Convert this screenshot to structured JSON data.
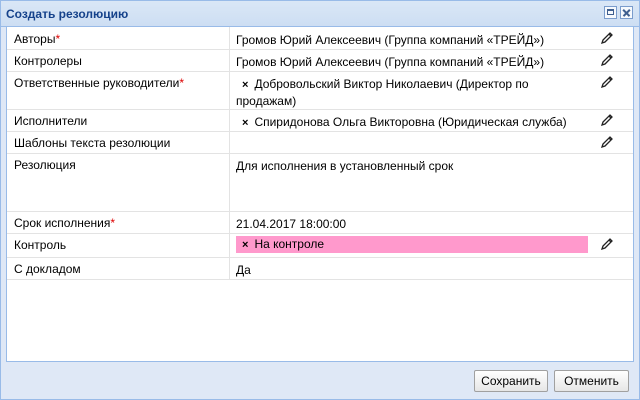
{
  "window": {
    "title": "Создать резолюцию"
  },
  "fields": {
    "authors": {
      "label": "Авторы",
      "required_mark": "*",
      "value": "Громов Юрий Алексеевич (Группа компаний «ТРЕЙД»)"
    },
    "controllers": {
      "label": "Контролеры",
      "value": "Громов Юрий Алексеевич (Группа компаний «ТРЕЙД»)"
    },
    "responsible": {
      "label": "Ответственные руководители",
      "required_mark": "*",
      "remove_glyph": "×",
      "value_line1": "Добровольский Виктор Николаевич (Директор по",
      "value_line2": "продажам)"
    },
    "executors": {
      "label": "Исполнители",
      "remove_glyph": "×",
      "value": "Спиридонова Ольга Викторовна (Юридическая служба)"
    },
    "templates": {
      "label": "Шаблоны текста резолюции",
      "value": ""
    },
    "resolution": {
      "label": "Резолюция",
      "value": "Для исполнения в установленный срок"
    },
    "deadline": {
      "label": "Срок исполнения",
      "required_mark": "*",
      "value": "21.04.2017 18:00:00"
    },
    "control": {
      "label": "Контроль",
      "remove_glyph": "×",
      "value": "На контроле",
      "highlight_color": "#ff99cc"
    },
    "report": {
      "label": "С докладом",
      "value": "Да"
    }
  },
  "buttons": {
    "save": "Сохранить",
    "cancel": "Отменить"
  },
  "icons": {
    "edit": "pencil-icon",
    "remove": "remove-icon",
    "maximize": "maximize-icon",
    "close": "close-icon"
  },
  "colors": {
    "title_text": "#15428b",
    "window_bg": "#dfe8f6",
    "required": "#dd0000"
  }
}
